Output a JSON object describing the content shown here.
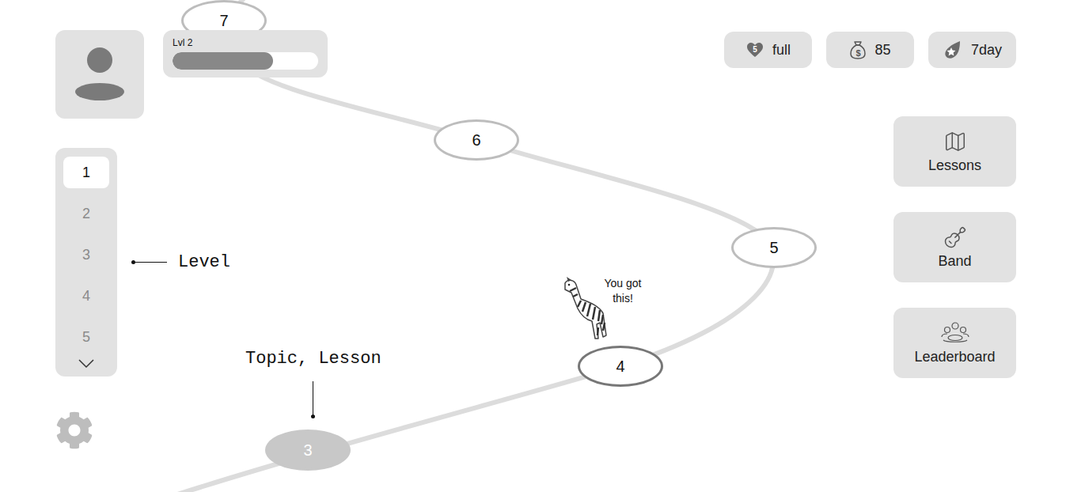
{
  "profile": {
    "level_label": "Lvl 2",
    "level": 0.69
  },
  "stats": [
    {
      "kind": "hearts",
      "badge": "5",
      "value": "full"
    },
    {
      "kind": "coins",
      "badge": "$",
      "value": "85"
    },
    {
      "kind": "streak",
      "value": "7day"
    }
  ],
  "nav": [
    {
      "kind": "lessons",
      "label": "Lessons"
    },
    {
      "kind": "band",
      "label": "Band"
    },
    {
      "kind": "leaderboard",
      "label": "Leaderboard"
    }
  ],
  "levels": [
    {
      "label": "1",
      "selected": true
    },
    {
      "label": "2",
      "selected": false
    },
    {
      "label": "3",
      "selected": false
    },
    {
      "label": "4",
      "selected": false
    },
    {
      "label": "5",
      "selected": false
    }
  ],
  "path": [
    {
      "label": "3",
      "status": "completed"
    },
    {
      "label": "4",
      "status": "current"
    },
    {
      "label": "5",
      "status": "locked"
    },
    {
      "label": "6",
      "status": "locked"
    },
    {
      "label": "7",
      "status": "locked"
    }
  ],
  "mascot": {
    "speech": "You got this!"
  },
  "annotations": {
    "levels": "Level",
    "lesson": "Topic, Lesson"
  }
}
